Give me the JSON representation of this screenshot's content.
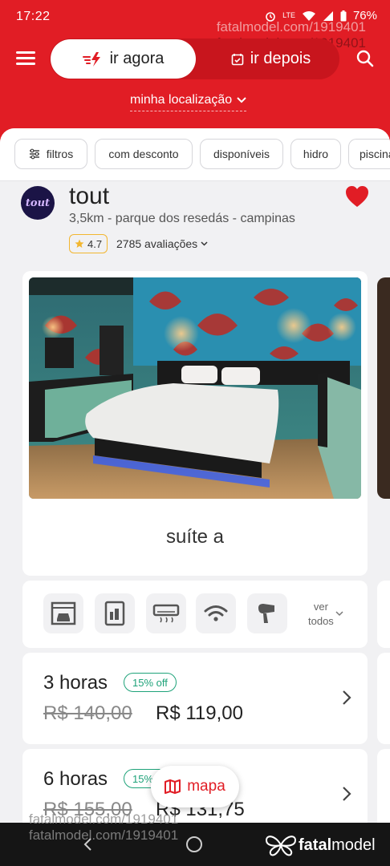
{
  "status": {
    "time": "17:22",
    "battery": "76%",
    "net": "LTE"
  },
  "watermark": {
    "line1": "fatalmodel.com/1919401",
    "line2": "fatalmodel.com/1919401"
  },
  "toggle": {
    "now_label": "ir agora",
    "later_label": "ir depois"
  },
  "location_label": "minha localização",
  "filters": [
    "filtros",
    "com desconto",
    "disponíveis",
    "hidro",
    "piscina"
  ],
  "motel": {
    "logo_text": "tout",
    "name": "tout",
    "address": "3,5km - parque dos resedás - campinas",
    "rating": "4.7",
    "reviews": "2785 avaliações",
    "favorite": true
  },
  "suite": {
    "name": "suíte a"
  },
  "amenities": [
    "garage-icon",
    "fridge-icon",
    "air-conditioning-icon",
    "wifi-icon",
    "hair-dryer-icon"
  ],
  "see_all": {
    "line1": "ver",
    "line2": "todos"
  },
  "prices": [
    {
      "period": "3 horas",
      "discount": "15% off",
      "old": "R$ 140,00",
      "new": "R$ 119,00"
    },
    {
      "period": "6 horas",
      "discount": "15% off",
      "old": "R$ 155,00",
      "new": "R$ 131,75"
    }
  ],
  "map_label": "mapa",
  "nav_watermark": {
    "line1": "fatalmodel.com/1919401",
    "line2": "fatalmodel.com/1919401"
  },
  "brand": {
    "prefix": "fatal",
    "suffix": "model"
  },
  "colors": {
    "accent": "#e11d25",
    "success": "#1fa37a",
    "star": "#f2b630"
  }
}
